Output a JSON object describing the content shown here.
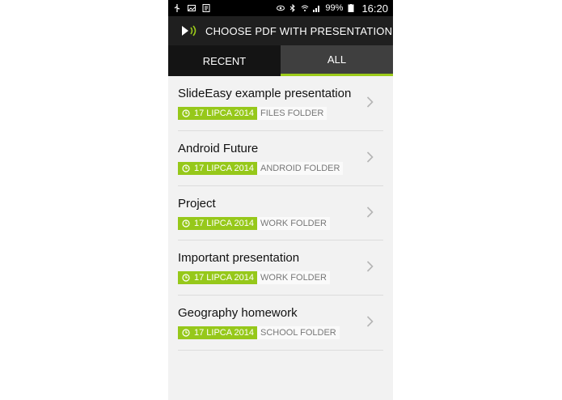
{
  "status_bar": {
    "icons": [
      "usb-icon",
      "image-icon",
      "document-icon",
      "eye-icon",
      "bluetooth-icon",
      "wifi-icon",
      "signal-icon",
      "battery-icon"
    ],
    "battery": "99%",
    "time": "16:20"
  },
  "header": {
    "title": "CHOOSE PDF WITH PRESENTATION"
  },
  "tabs": [
    {
      "label": "RECENT",
      "selected": false
    },
    {
      "label": "ALL",
      "selected": true
    }
  ],
  "files": [
    {
      "title": "SlideEasy example presentation",
      "date": "17 LIPCA 2014",
      "folder": "FILES FOLDER"
    },
    {
      "title": "Android Future",
      "date": "17 LIPCA 2014",
      "folder": "ANDROID FOLDER"
    },
    {
      "title": "Project",
      "date": "17 LIPCA 2014",
      "folder": "WORK FOLDER"
    },
    {
      "title": "Important presentation",
      "date": "17 LIPCA 2014",
      "folder": "WORK FOLDER"
    },
    {
      "title": "Geography homework",
      "date": "17 LIPCA 2014",
      "folder": "SCHOOL FOLDER"
    }
  ],
  "colors": {
    "accent": "#96c81a",
    "header_bg": "#1f1f1f",
    "tab_selected_bg": "#3f3f3f"
  }
}
